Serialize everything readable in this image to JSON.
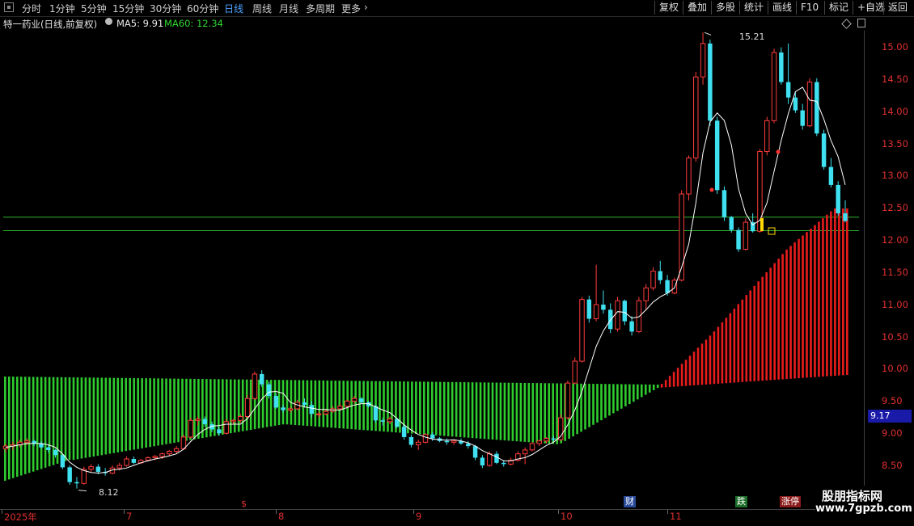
{
  "toolbar": {
    "periods": [
      "分时",
      "1分钟",
      "5分钟",
      "15分钟",
      "30分钟",
      "60分钟",
      "日线",
      "周线",
      "月线",
      "多周期",
      "更多"
    ],
    "active_period": "日线",
    "more_label": "更多",
    "buttons": [
      "复权",
      "叠加",
      "多股",
      "统计",
      "画线",
      "F10",
      "标记",
      "+自选",
      "返回"
    ]
  },
  "header": {
    "stock_title": "特一药业(日线,前复权)",
    "ma5": "MA5: 9.91",
    "ma60": "MA60: 12.34"
  },
  "colors": {
    "up": "#ff3b3b",
    "down": "#3fe0f0",
    "ma5": "#ffffff",
    "green_bars": "#2ecc2e",
    "red_bars": "#e81c1c",
    "hline": "#2db52d",
    "axis_text": "#e03030"
  },
  "price_axis": {
    "ticks": [
      "15.00",
      "14.50",
      "14.00",
      "13.50",
      "13.00",
      "12.50",
      "12.00",
      "11.50",
      "11.00",
      "10.50",
      "10.00",
      "9.50",
      "9.00",
      "8.50"
    ],
    "current_price": "9.17"
  },
  "time_axis": {
    "labels": [
      "2025年",
      "7",
      "8",
      "9",
      "10",
      "11"
    ]
  },
  "annotations": {
    "high": "15.21",
    "low": "8.12"
  },
  "event_markers": {
    "s": "$",
    "cai": "财",
    "die": "跌",
    "zhang": "涨停"
  },
  "watermark": {
    "title": "股朋指标网",
    "url": "www.7gpzb.com"
  },
  "chart_data": {
    "type": "candlestick",
    "ylim": [
      8.3,
      15.5
    ],
    "horizontal_levels": [
      12.34,
      12.13
    ],
    "ohlc": [
      [
        8.74,
        8.82,
        8.68,
        8.78
      ],
      [
        8.78,
        8.85,
        8.72,
        8.8
      ],
      [
        8.8,
        8.88,
        8.76,
        8.84
      ],
      [
        8.84,
        8.9,
        8.8,
        8.86
      ],
      [
        8.86,
        8.88,
        8.78,
        8.82
      ],
      [
        8.82,
        8.86,
        8.74,
        8.76
      ],
      [
        8.76,
        8.8,
        8.68,
        8.72
      ],
      [
        8.72,
        8.74,
        8.6,
        8.64
      ],
      [
        8.64,
        8.66,
        8.42,
        8.45
      ],
      [
        8.45,
        8.48,
        8.18,
        8.22
      ],
      [
        8.22,
        8.3,
        8.12,
        8.2
      ],
      [
        8.2,
        8.46,
        8.18,
        8.42
      ],
      [
        8.42,
        8.5,
        8.38,
        8.46
      ],
      [
        8.46,
        8.5,
        8.34,
        8.38
      ],
      [
        8.38,
        8.44,
        8.32,
        8.36
      ],
      [
        8.36,
        8.48,
        8.34,
        8.44
      ],
      [
        8.44,
        8.52,
        8.4,
        8.48
      ],
      [
        8.48,
        8.62,
        8.46,
        8.58
      ],
      [
        8.58,
        8.62,
        8.5,
        8.52
      ],
      [
        8.52,
        8.58,
        8.5,
        8.56
      ],
      [
        8.56,
        8.62,
        8.54,
        8.6
      ],
      [
        8.6,
        8.64,
        8.56,
        8.62
      ],
      [
        8.62,
        8.68,
        8.58,
        8.66
      ],
      [
        8.66,
        8.72,
        8.62,
        8.7
      ],
      [
        8.7,
        8.78,
        8.66,
        8.74
      ],
      [
        8.74,
        8.96,
        8.72,
        8.92
      ],
      [
        8.92,
        9.22,
        8.9,
        9.18
      ],
      [
        9.18,
        9.24,
        9.1,
        9.2
      ],
      [
        9.2,
        9.24,
        9.08,
        9.12
      ],
      [
        9.12,
        9.16,
        9.0,
        9.04
      ],
      [
        9.04,
        9.08,
        8.94,
        8.98
      ],
      [
        8.98,
        9.2,
        8.96,
        9.16
      ],
      [
        9.16,
        9.2,
        9.12,
        9.18
      ],
      [
        9.18,
        9.28,
        9.14,
        9.24
      ],
      [
        9.24,
        9.58,
        9.2,
        9.52
      ],
      [
        9.52,
        9.94,
        9.5,
        9.9
      ],
      [
        9.9,
        9.96,
        9.7,
        9.74
      ],
      [
        9.74,
        9.78,
        9.52,
        9.56
      ],
      [
        9.56,
        9.6,
        9.36,
        9.38
      ],
      [
        9.38,
        9.42,
        9.3,
        9.34
      ],
      [
        9.34,
        9.4,
        9.3,
        9.36
      ],
      [
        9.36,
        9.5,
        9.34,
        9.46
      ],
      [
        9.46,
        9.52,
        9.38,
        9.42
      ],
      [
        9.42,
        9.48,
        9.22,
        9.28
      ],
      [
        9.28,
        9.32,
        9.22,
        9.28
      ],
      [
        9.28,
        9.36,
        9.26,
        9.32
      ],
      [
        9.32,
        9.4,
        9.3,
        9.36
      ],
      [
        9.36,
        9.44,
        9.34,
        9.4
      ],
      [
        9.4,
        9.5,
        9.38,
        9.48
      ],
      [
        9.48,
        9.56,
        9.44,
        9.52
      ],
      [
        9.52,
        9.54,
        9.44,
        9.46
      ],
      [
        9.46,
        9.48,
        9.38,
        9.4
      ],
      [
        9.4,
        9.42,
        9.14,
        9.18
      ],
      [
        9.18,
        9.22,
        9.1,
        9.16
      ],
      [
        9.16,
        9.24,
        9.12,
        9.2
      ],
      [
        9.2,
        9.22,
        9.06,
        9.08
      ],
      [
        9.08,
        9.12,
        8.88,
        8.92
      ],
      [
        8.92,
        8.96,
        8.76,
        8.8
      ],
      [
        8.8,
        8.88,
        8.72,
        8.84
      ],
      [
        8.84,
        8.98,
        8.82,
        8.96
      ],
      [
        8.96,
        9.0,
        8.86,
        8.9
      ],
      [
        8.9,
        8.92,
        8.84,
        8.86
      ],
      [
        8.86,
        8.9,
        8.8,
        8.84
      ],
      [
        8.84,
        8.88,
        8.8,
        8.86
      ],
      [
        8.86,
        8.9,
        8.8,
        8.82
      ],
      [
        8.82,
        8.86,
        8.74,
        8.78
      ],
      [
        8.78,
        8.8,
        8.56,
        8.6
      ],
      [
        8.6,
        8.64,
        8.44,
        8.48
      ],
      [
        8.48,
        8.7,
        8.46,
        8.66
      ],
      [
        8.66,
        8.7,
        8.5,
        8.52
      ],
      [
        8.52,
        8.56,
        8.46,
        8.5
      ],
      [
        8.5,
        8.6,
        8.48,
        8.56
      ],
      [
        8.56,
        8.7,
        8.54,
        8.66
      ],
      [
        8.66,
        8.76,
        8.5,
        8.72
      ],
      [
        8.72,
        8.84,
        8.7,
        8.82
      ],
      [
        8.82,
        8.88,
        8.78,
        8.86
      ],
      [
        8.86,
        8.92,
        8.82,
        8.9
      ],
      [
        8.9,
        8.94,
        8.84,
        8.88
      ],
      [
        8.88,
        9.28,
        8.86,
        9.22
      ],
      [
        9.22,
        9.8,
        9.2,
        9.76
      ],
      [
        9.76,
        10.16,
        9.74,
        10.1
      ],
      [
        10.1,
        11.1,
        10.08,
        11.06
      ],
      [
        11.06,
        11.12,
        10.7,
        10.76
      ],
      [
        10.76,
        11.6,
        10.72,
        10.98
      ],
      [
        10.98,
        11.2,
        10.84,
        10.9
      ],
      [
        10.9,
        11.0,
        10.54,
        10.6
      ],
      [
        10.6,
        11.1,
        10.56,
        11.04
      ],
      [
        11.04,
        11.06,
        10.66,
        10.72
      ],
      [
        10.72,
        10.8,
        10.5,
        10.56
      ],
      [
        10.56,
        11.1,
        10.54,
        11.04
      ],
      [
        11.04,
        11.3,
        10.9,
        11.24
      ],
      [
        11.24,
        11.56,
        11.2,
        11.5
      ],
      [
        11.5,
        11.66,
        11.3,
        11.36
      ],
      [
        11.36,
        11.44,
        11.12,
        11.16
      ],
      [
        11.16,
        11.4,
        11.14,
        11.36
      ],
      [
        11.36,
        12.76,
        11.34,
        12.7
      ],
      [
        12.7,
        13.3,
        12.6,
        13.26
      ],
      [
        13.26,
        14.6,
        13.2,
        14.52
      ],
      [
        14.52,
        15.21,
        14.4,
        15.04
      ],
      [
        15.04,
        15.1,
        13.76,
        13.84
      ],
      [
        13.84,
        13.9,
        12.7,
        12.76
      ],
      [
        12.76,
        12.82,
        12.28,
        12.34
      ],
      [
        12.34,
        12.36,
        12.1,
        12.14
      ],
      [
        12.14,
        12.18,
        11.8,
        11.84
      ],
      [
        11.84,
        12.32,
        11.82,
        12.26
      ],
      [
        12.26,
        12.4,
        12.1,
        12.12
      ],
      [
        12.12,
        13.4,
        12.1,
        13.36
      ],
      [
        13.36,
        13.9,
        13.3,
        13.84
      ],
      [
        13.84,
        14.96,
        13.8,
        14.9
      ],
      [
        14.9,
        14.98,
        14.4,
        14.44
      ],
      [
        14.44,
        15.04,
        14.1,
        14.2
      ],
      [
        14.2,
        14.28,
        13.96,
        14.0
      ],
      [
        14.0,
        14.1,
        13.7,
        13.76
      ],
      [
        13.76,
        14.5,
        13.74,
        14.44
      ],
      [
        14.44,
        14.5,
        13.6,
        13.64
      ],
      [
        13.64,
        13.7,
        13.08,
        13.12
      ],
      [
        13.12,
        13.26,
        12.8,
        12.84
      ],
      [
        12.84,
        12.9,
        12.36,
        12.4
      ],
      [
        12.4,
        12.6,
        12.26,
        12.28
      ]
    ],
    "ma5": [
      8.76,
      8.78,
      8.8,
      8.82,
      8.82,
      8.82,
      8.8,
      8.76,
      8.66,
      8.53,
      8.45,
      8.4,
      8.37,
      8.36,
      8.37,
      8.41,
      8.42,
      8.44,
      8.48,
      8.52,
      8.55,
      8.58,
      8.6,
      8.63,
      8.66,
      8.73,
      8.85,
      8.96,
      9.04,
      9.09,
      9.1,
      9.12,
      9.12,
      9.12,
      9.21,
      9.36,
      9.51,
      9.62,
      9.63,
      9.6,
      9.46,
      9.42,
      9.39,
      9.37,
      9.35,
      9.35,
      9.34,
      9.34,
      9.38,
      9.42,
      9.44,
      9.44,
      9.39,
      9.34,
      9.3,
      9.21,
      9.11,
      9.03,
      8.96,
      8.92,
      8.89,
      8.88,
      8.87,
      8.88,
      8.86,
      8.83,
      8.78,
      8.71,
      8.66,
      8.61,
      8.55,
      8.55,
      8.58,
      8.6,
      8.65,
      8.72,
      8.79,
      8.84,
      8.93,
      9.11,
      9.34,
      9.63,
      9.98,
      10.33,
      10.57,
      10.74,
      10.87,
      10.86,
      10.77,
      10.79,
      10.9,
      11.02,
      11.1,
      11.16,
      11.24,
      11.56,
      11.92,
      12.56,
      13.34,
      13.82,
      13.96,
      13.84,
      13.46,
      12.78,
      12.4,
      12.22,
      12.29,
      12.56,
      13.05,
      13.53,
      13.95,
      14.29,
      14.36,
      14.16,
      14.14,
      13.86,
      13.53,
      13.28,
      12.84
    ]
  }
}
